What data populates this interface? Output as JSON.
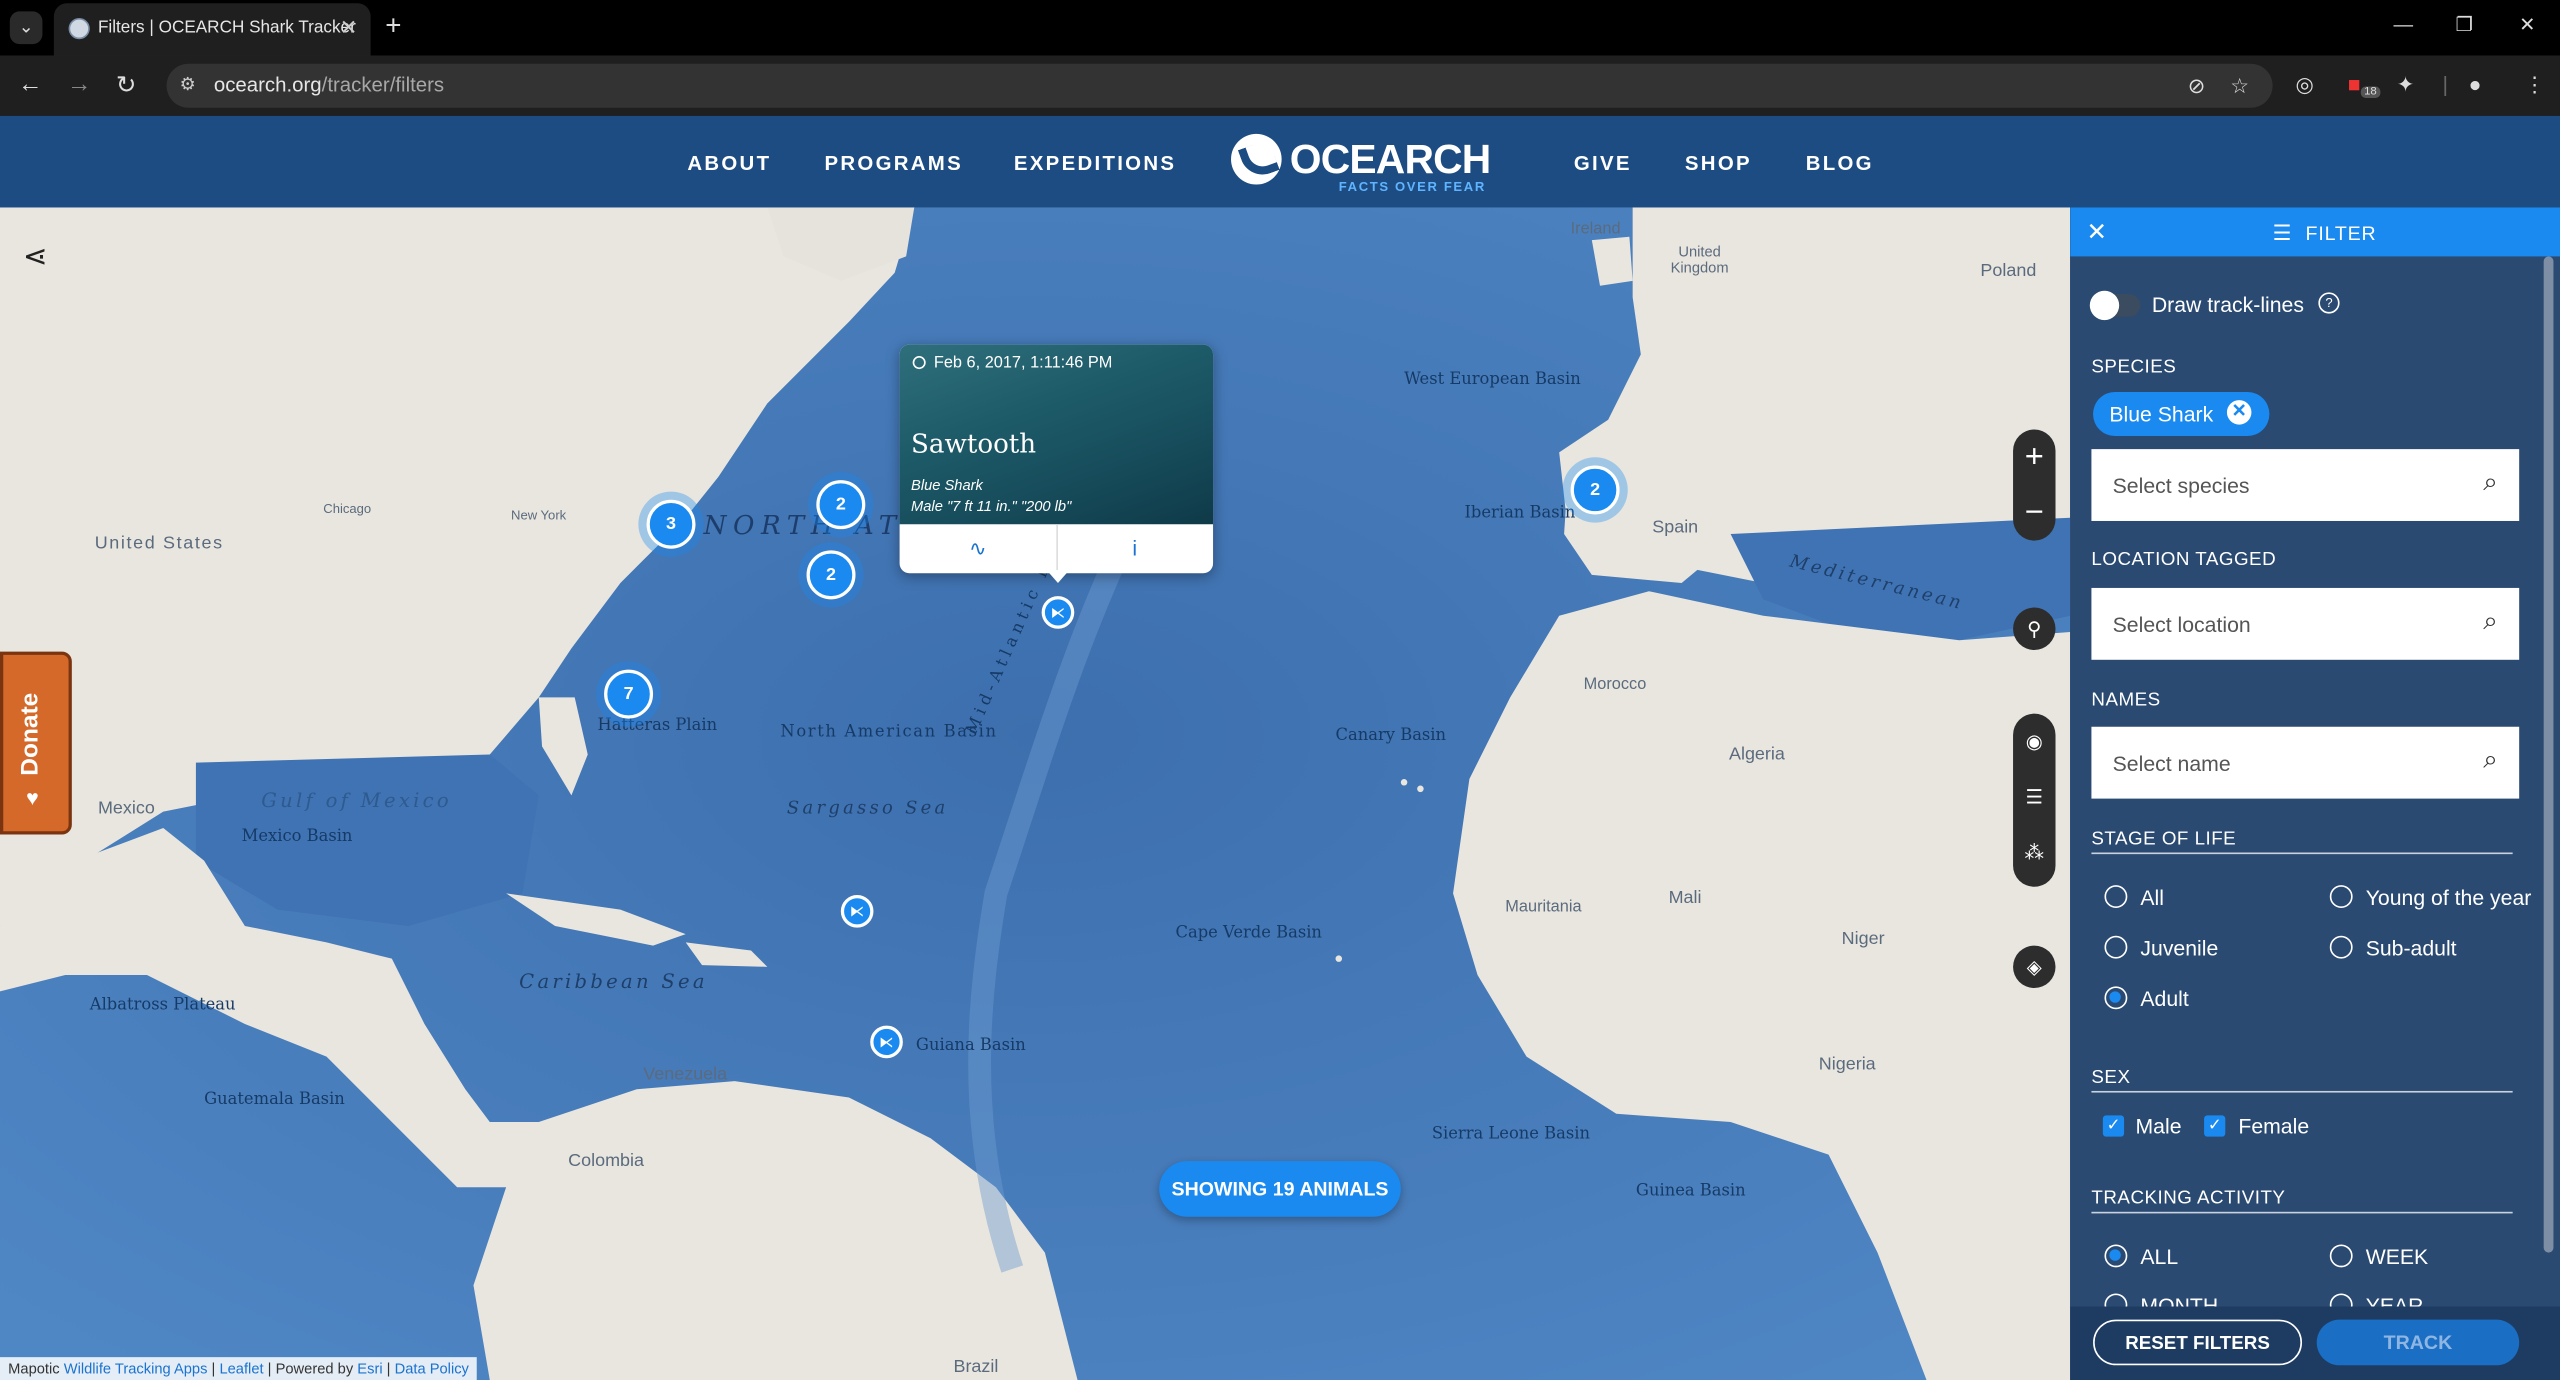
{
  "browser": {
    "tab_title": "Filters | OCEARCH Shark Tracker",
    "url_host": "ocearch.org",
    "url_path": "/tracker/filters",
    "ext_badge": "18"
  },
  "header": {
    "nav_left": [
      "ABOUT",
      "PROGRAMS",
      "EXPEDITIONS"
    ],
    "logo_text": "OCEARCH",
    "logo_tagline": "FACTS OVER FEAR",
    "nav_right": [
      "GIVE",
      "SHOP",
      "BLOG"
    ]
  },
  "map": {
    "labels": {
      "north_atlantic": "NORTH ATLANTIC",
      "united_states": "United States",
      "mexico": "Mexico",
      "gulf_of_mexico": "Gulf of Mexico",
      "caribbean_sea": "Caribbean Sea",
      "sargasso_sea": "Sargasso Sea",
      "na_basin": "North American Basin",
      "mid_atlantic_ridge": "Mid-Atlantic Ridge",
      "west_european_basin": "West European Basin",
      "iberian_basin": "Iberian Basin",
      "canary_basin": "Canary Basin",
      "cape_verde_basin": "Cape Verde Basin",
      "guiana_basin": "Guiana Basin",
      "sierra_leone_basin": "Sierra Leone Basin",
      "guinea_basin": "Guinea Basin",
      "hatteras_plain": "Hatteras Plain",
      "albatross_plateau": "Albatross Plateau",
      "guatemala_basin": "Guatemala Basin",
      "mexico_basin": "Mexico Basin",
      "venezuela": "Venezuela",
      "colombia": "Colombia",
      "brazil": "Brazil",
      "algeria": "Algeria",
      "mali": "Mali",
      "niger": "Niger",
      "nigeria": "Nigeria",
      "mauritania": "Mauritania",
      "morocco": "Morocco",
      "spain": "Spain",
      "ireland": "Ireland",
      "united_kingdom": "United Kingdom",
      "poland": "Poland",
      "mediterranean": "Mediterranean",
      "chicago": "Chicago",
      "new_york": "New York"
    },
    "clusters": [
      "3",
      "2",
      "2",
      "7",
      "2"
    ],
    "popup": {
      "date": "Feb 6, 2017, 1:11:46 PM",
      "name": "Sawtooth",
      "species": "Blue Shark",
      "measurements": "Male \"7 ft 11 in.\" \"200 lb\""
    },
    "showing": "SHOWING 19 ANIMALS",
    "donate": "Donate",
    "attribution": {
      "prefix": "Mapotic",
      "link1": "Wildlife Tracking Apps",
      "link2": "Leaflet",
      "powered": "Powered by",
      "link3": "Esri",
      "link4": "Data Policy"
    }
  },
  "filter": {
    "title": "FILTER",
    "draw_tracklines": "Draw track-lines",
    "species_label": "SPECIES",
    "species_chip": "Blue Shark",
    "species_placeholder": "Select species",
    "location_label": "LOCATION TAGGED",
    "location_placeholder": "Select location",
    "names_label": "NAMES",
    "names_placeholder": "Select name",
    "stage_label": "STAGE OF LIFE",
    "stages": [
      "All",
      "Young of the year",
      "Juvenile",
      "Sub-adult",
      "Adult"
    ],
    "stage_selected": "Adult",
    "sex_label": "SEX",
    "sex_options": [
      "Male",
      "Female"
    ],
    "activity_label": "TRACKING ACTIVITY",
    "activity": [
      "ALL",
      "WEEK",
      "MONTH",
      "YEAR"
    ],
    "activity_selected": "ALL",
    "reset": "RESET FILTERS",
    "track": "TRACK"
  },
  "colors": {
    "accent": "#1a8af0",
    "header": "#1d4c83",
    "donate": "#d5692a"
  }
}
